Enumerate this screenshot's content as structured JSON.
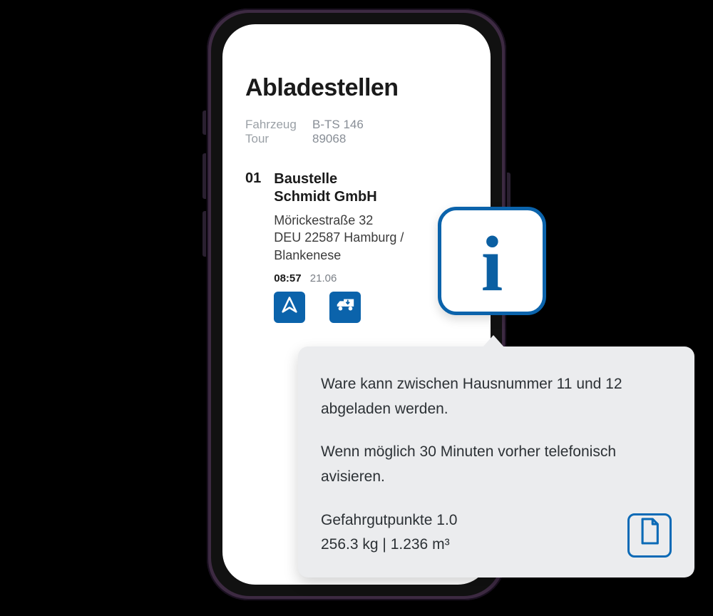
{
  "header": {
    "title": "Abladestellen"
  },
  "meta": {
    "vehicle_label": "Fahrzeug",
    "vehicle_value": "B-TS 146",
    "tour_label": "Tour",
    "tour_value": "89068"
  },
  "stop": {
    "number": "01",
    "name_line1": "Baustelle",
    "name_line2": "Schmidt GmbH",
    "street": "Mörickestraße 32",
    "city": "DEU 22587 Hamburg / Blankenese",
    "time": "08:57",
    "date": "21.06"
  },
  "info_popup": {
    "paragraph1": "Ware kann zwischen Hausnummer 11 und 12 abgeladen werden.",
    "paragraph2": "Wenn möglich 30 Minuten vorher telefonisch avisieren.",
    "hazard_line": "Gefahrgutpunkte 1.0",
    "weight_volume_line": "256.3 kg  |  1.236 m³"
  },
  "colors": {
    "accent": "#0b63ab"
  }
}
